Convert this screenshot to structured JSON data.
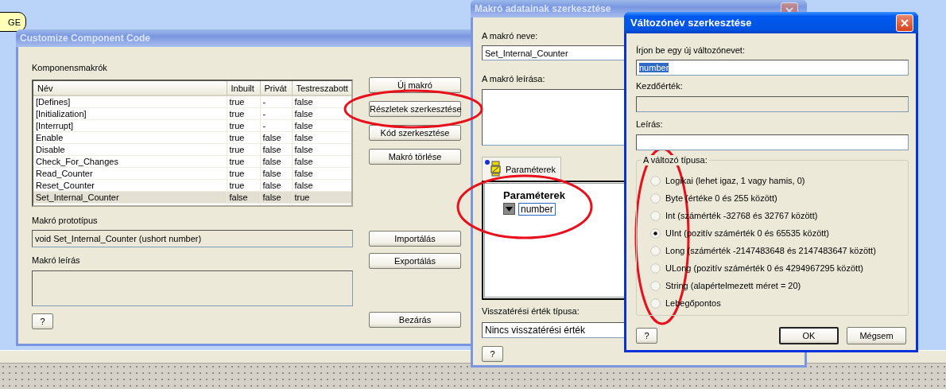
{
  "canvas_tag": {
    "text": "GE"
  },
  "customize_window": {
    "title": "Customize Component Code",
    "macros_label": "Komponensmakrók",
    "table": {
      "columns": [
        "Név",
        "Inbuilt",
        "Privát",
        "Testreszabott"
      ],
      "rows": [
        {
          "cells": [
            "[Defines]",
            "true",
            "-",
            "false"
          ],
          "selected": false
        },
        {
          "cells": [
            "[Initialization]",
            "true",
            "-",
            "false"
          ],
          "selected": false
        },
        {
          "cells": [
            "[Interrupt]",
            "true",
            "-",
            "false"
          ],
          "selected": false
        },
        {
          "cells": [
            "Enable",
            "true",
            "false",
            "false"
          ],
          "selected": false
        },
        {
          "cells": [
            "Disable",
            "true",
            "false",
            "false"
          ],
          "selected": false
        },
        {
          "cells": [
            "Check_For_Changes",
            "true",
            "false",
            "false"
          ],
          "selected": false
        },
        {
          "cells": [
            "Read_Counter",
            "true",
            "false",
            "false"
          ],
          "selected": false
        },
        {
          "cells": [
            "Reset_Counter",
            "true",
            "false",
            "false"
          ],
          "selected": false
        },
        {
          "cells": [
            "Set_Internal_Counter",
            "false",
            "false",
            "true"
          ],
          "selected": true
        }
      ]
    },
    "macro_buttons": [
      "Új makró",
      "Részletek szerkesztése",
      "Kód szerkesztése",
      "Makró törlése"
    ],
    "prototype_label": "Makró prototípus",
    "prototype_value": "void Set_Internal_Counter (ushort number)",
    "description_label": "Makró leírás",
    "help_button": "?",
    "io_buttons": [
      "Importálás",
      "Exportálás"
    ],
    "close_button": "Bezárás"
  },
  "macro_window": {
    "title": "Makró adatainak szerkesztése",
    "name_label": "A makró neve:",
    "name_value": "Set_Internal_Counter",
    "description_label": "A makró leírása:",
    "tab": "Paraméterek",
    "tree": {
      "label": "Paraméterek",
      "children": [
        {
          "label": "number",
          "selected": true
        }
      ]
    },
    "return_label": "Visszatérési érték típusa:",
    "return_value": "Nincs visszatérési érték",
    "help_button": "?"
  },
  "variable_window": {
    "title": "Változónév szerkesztése",
    "name_label": "Írjon be egy új változónevet:",
    "name_value": "number",
    "initial_label": "Kezdőérték:",
    "description_label": "Leírás:",
    "type_group": "A változó típusa:",
    "types": [
      {
        "label": "Logikai (lehet igaz, 1 vagy hamis, 0)",
        "selected": false
      },
      {
        "label": "Byte (értéke 0 és 255 között)",
        "selected": false
      },
      {
        "label": "Int (számérték -32768 és 32767 között)",
        "selected": false
      },
      {
        "label": "UInt (pozitív számérték 0 és 65535 között)",
        "selected": true
      },
      {
        "label": "Long (számérték -2147483648 és 2147483647 között)",
        "selected": false
      },
      {
        "label": "ULong (pozitív számérték 0 és 4294967295 között)",
        "selected": false
      },
      {
        "label": "String (alapértelmezett méret = 20)",
        "selected": false
      },
      {
        "label": "Lebegőpontos",
        "selected": false
      }
    ],
    "help_button": "?",
    "ok_button": "OK",
    "cancel_button": "Mégsem"
  }
}
